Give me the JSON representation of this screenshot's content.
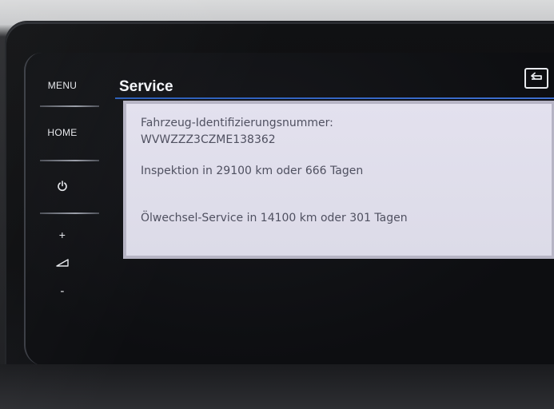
{
  "side_panel": {
    "menu_label": "MENU",
    "home_label": "HOME",
    "power_icon": "power-icon",
    "volume_up_label": "+",
    "volume_icon": "volume-icon",
    "volume_down_label": "-"
  },
  "header": {
    "title": "Service",
    "back_icon": "back-arrow-icon",
    "accent_color": "#3f6fd0"
  },
  "service_info": {
    "vin_label": "Fahrzeug-Identifizierungsnummer:",
    "vin_value": "WVWZZZ3CZME138362",
    "inspection": "Inspektion in 29100 km oder 666 Tagen",
    "oil_change": "Ölwechsel-Service in 14100 km oder 301 Tagen"
  }
}
